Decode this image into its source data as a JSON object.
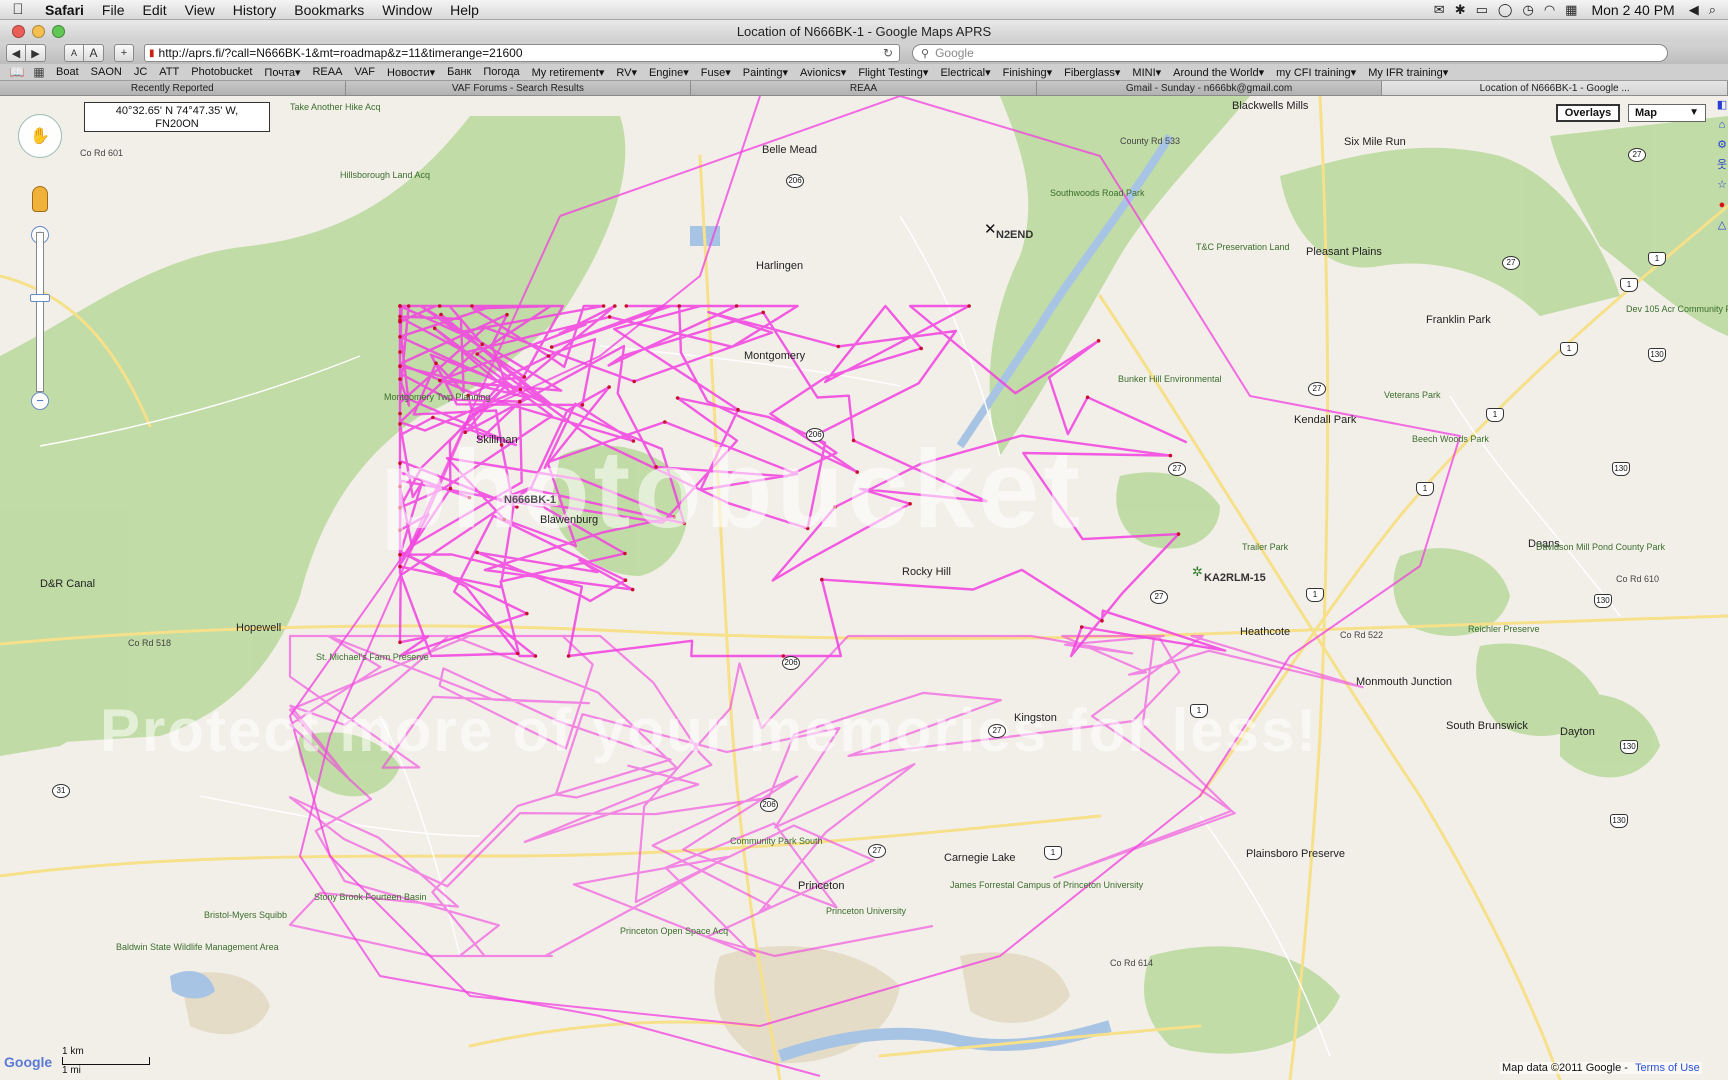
{
  "menubar": {
    "apple": "",
    "app": "Safari",
    "items": [
      "File",
      "Edit",
      "View",
      "History",
      "Bookmarks",
      "Window",
      "Help"
    ],
    "clock": "Mon 2 40 PM"
  },
  "window": {
    "title": "Location of N666BK-1 - Google Maps APRS"
  },
  "toolbar": {
    "back": "◀",
    "forward": "▶",
    "text_smaller": "A",
    "text_larger": "A",
    "add": "+",
    "url": "http://aprs.fi/?call=N666BK-1&mt=roadmap&z=11&timerange=21600",
    "search_placeholder": "Google"
  },
  "bookmarks": [
    "Boat",
    "SAON",
    "JC",
    "ATT",
    "Photobucket",
    "Почта▾",
    "REAA",
    "VAF",
    "Новости▾",
    "Банк",
    "Погода",
    "My retirement▾",
    "RV▾",
    "Engine▾",
    "Fuse▾",
    "Painting▾",
    "Avionics▾",
    "Flight Testing▾",
    "Electrical▾",
    "Finishing▾",
    "Fiberglass▾",
    "MINI▾",
    "Around the World▾",
    "my CFI training▾",
    "My IFR training▾"
  ],
  "tabs": [
    {
      "label": "Recently Reported"
    },
    {
      "label": "VAF Forums - Search Results"
    },
    {
      "label": "REAA"
    },
    {
      "label": "Gmail - Sunday - n666bk@gmail.com"
    },
    {
      "label": "Location of N666BK-1 - Google ..."
    }
  ],
  "map": {
    "coords_line1": "40°32.65' N 74°47.35' W,",
    "coords_line2": "FN20ON",
    "overlays_label": "Overlays",
    "maptype_label": "Map",
    "stations": {
      "self": "N666BK-1",
      "s1": "KA2RLM-15",
      "s2": "N2END"
    },
    "towns": {
      "princeton": "Princeton",
      "hopewell": "Hopewell",
      "rocky_hill": "Rocky Hill",
      "montgomery": "Montgomery",
      "kendall_park": "Kendall Park",
      "franklin_park": "Franklin Park",
      "heathcote": "Heathcote",
      "deans": "Deans",
      "harlingen": "Harlingen",
      "belle_mead": "Belle Mead",
      "blawenburg": "Blawenburg",
      "kingston": "Kingston",
      "pleasant_plains": "Pleasant Plains",
      "monmouth_junction": "Monmouth Junction",
      "south_brunswick": "South Brunswick",
      "dayton": "Dayton",
      "blackwells_mills": "Blackwells Mills",
      "six_mile_run": "Six Mile Run",
      "skillman": "Skillman",
      "dr_canal": "D&R Canal",
      "plainsboro_preserve": "Plainsboro Preserve",
      "carnegie_lake": "Carnegie Lake"
    },
    "green_labels": {
      "hillsborough": "Hillsborough Land Acq",
      "mtgy_twp": "Montgomery Twp Planning",
      "st_michaels": "St. Michael's Farm Preserve",
      "stony_brook": "Stony Brook Fourteen Basin",
      "baldwin": "Baldwin State Wildlife Management Area",
      "bristol": "Bristol-Myers Squibb",
      "princeton_univ": "Princeton University",
      "forrestal": "James Forrestal Campus of Princeton University",
      "bunker_hill": "Bunker Hill Environmental",
      "tc_preserve": "T&C Preservation Land",
      "dev105": "Dev 105 Acr Community P",
      "veterans_park": "Veterans Park",
      "beech_woods": "Beech Woods Park",
      "davidson_mill": "Davidson Mill Pond County Park",
      "trailer_park": "Trailer Park",
      "reichler": "Reichler Preserve",
      "community_park": "Community Park South",
      "princeton_open": "Princeton Open Space Acq",
      "southwoods": "Southwoods Road Park",
      "take_another": "Take Another Hike Acq"
    },
    "roads": {
      "r206": "206",
      "r27": "27",
      "r1": "1",
      "r130": "130",
      "r31": "31",
      "r518": "Co Rd 518",
      "r601": "Co Rd 601",
      "r610": "Co Rd 610",
      "r522": "Co Rd 522",
      "r614": "Co Rd 614",
      "county": "County Rd 533"
    },
    "scale_km": "1 km",
    "scale_mi": "1 mi",
    "google": "Google",
    "credit": "Map data ©2011 Google -",
    "terms": "Terms of Use",
    "watermark1": "photobucket",
    "watermark2": "Protect more of your memories for less!"
  },
  "colors": {
    "track": "#f23fe0",
    "water": "#a8c4e4",
    "park": "#b8d89a",
    "road": "#f7e08a"
  }
}
